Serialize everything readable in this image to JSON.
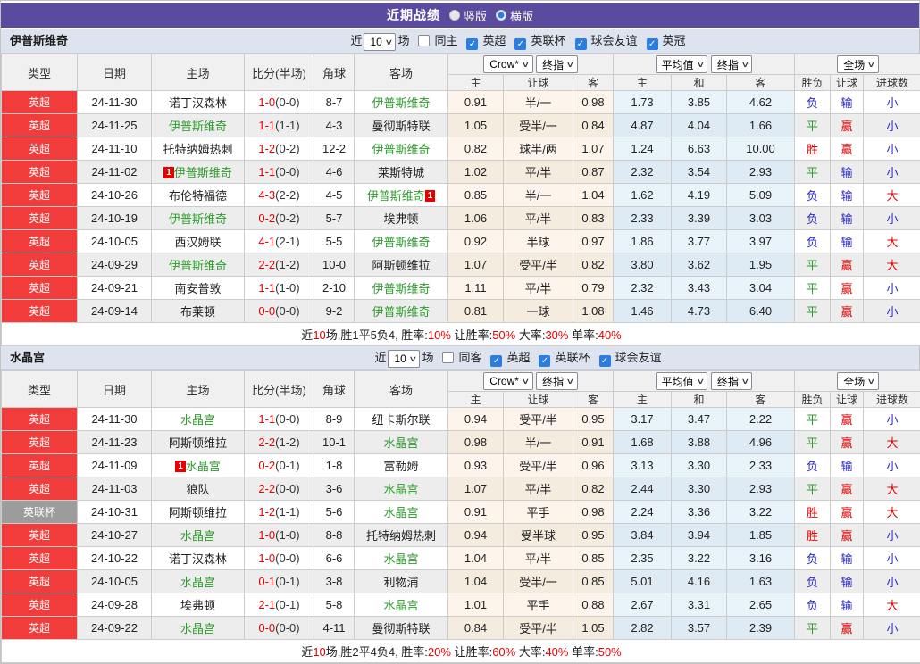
{
  "title_bar": {
    "title": "近期战绩",
    "vertical_label": "竖版",
    "horizontal_label": "横版",
    "selected": "横版"
  },
  "colors": {
    "accent_purple": "#5a4b9f",
    "type_red": "#f23c3c",
    "type_grey": "#9c9c9c",
    "team_green": "#2e9b2e",
    "win_red": "#e60000",
    "lose_blue": "#2a2ace",
    "draw_green": "#2e9b2e"
  },
  "table_header": {
    "cols": {
      "type": "类型",
      "date": "日期",
      "home": "主场",
      "score": "比分(半场)",
      "corner": "角球",
      "away": "客场"
    },
    "selects": {
      "crow": "Crow*",
      "end1": "终指",
      "avg": "平均值",
      "end2": "终指",
      "scope": "全场"
    },
    "sub": [
      "主",
      "让球",
      "客",
      "主",
      "和",
      "客",
      "胜负",
      "让球",
      "进球数"
    ]
  },
  "sections": [
    {
      "team": "伊普斯维奇",
      "filter": {
        "near": "近",
        "count": "10",
        "unit": "场",
        "same_label": "同主",
        "same_checked": false,
        "leagues": [
          "英超",
          "英联杯",
          "球会友谊",
          "英冠"
        ]
      },
      "rows": [
        {
          "type": "英超",
          "grey": false,
          "date": "24-11-30",
          "home": {
            "name": "诺丁汉森林"
          },
          "ft": "1-0",
          "ht": "(0-0)",
          "corner": "8-7",
          "away": {
            "name": "伊普斯维奇",
            "green": true
          },
          "odds": [
            "0.91",
            "半/一",
            "0.98"
          ],
          "avg": [
            "1.73",
            "3.85",
            "4.62"
          ],
          "res": [
            "负",
            "输",
            "小"
          ]
        },
        {
          "type": "英超",
          "grey": false,
          "date": "24-11-25",
          "home": {
            "name": "伊普斯维奇",
            "green": true
          },
          "ft": "1-1",
          "ht": "(1-1)",
          "corner": "4-3",
          "away": {
            "name": "曼彻斯特联"
          },
          "odds": [
            "1.05",
            "受半/一",
            "0.84"
          ],
          "avg": [
            "4.87",
            "4.04",
            "1.66"
          ],
          "res": [
            "平",
            "赢",
            "小"
          ]
        },
        {
          "type": "英超",
          "grey": false,
          "date": "24-11-10",
          "home": {
            "name": "托特纳姆热刺"
          },
          "ft": "1-2",
          "ht": "(0-2)",
          "corner": "12-2",
          "away": {
            "name": "伊普斯维奇",
            "green": true
          },
          "odds": [
            "0.82",
            "球半/两",
            "1.07"
          ],
          "avg": [
            "1.24",
            "6.63",
            "10.00"
          ],
          "res": [
            "胜",
            "赢",
            "小"
          ]
        },
        {
          "type": "英超",
          "grey": false,
          "date": "24-11-02",
          "home": {
            "name": "伊普斯维奇",
            "green": true,
            "badge": "1",
            "badge_pos": "before"
          },
          "ft": "1-1",
          "ht": "(0-0)",
          "corner": "4-6",
          "away": {
            "name": "莱斯特城"
          },
          "odds": [
            "1.02",
            "平/半",
            "0.87"
          ],
          "avg": [
            "2.32",
            "3.54",
            "2.93"
          ],
          "res": [
            "平",
            "输",
            "小"
          ]
        },
        {
          "type": "英超",
          "grey": false,
          "date": "24-10-26",
          "home": {
            "name": "布伦特福德"
          },
          "ft": "4-3",
          "ht": "(2-2)",
          "corner": "4-5",
          "away": {
            "name": "伊普斯维奇",
            "green": true,
            "badge": "1",
            "badge_pos": "after"
          },
          "odds": [
            "0.85",
            "半/一",
            "1.04"
          ],
          "avg": [
            "1.62",
            "4.19",
            "5.09"
          ],
          "res": [
            "负",
            "输",
            "大"
          ]
        },
        {
          "type": "英超",
          "grey": false,
          "date": "24-10-19",
          "home": {
            "name": "伊普斯维奇",
            "green": true
          },
          "ft": "0-2",
          "ht": "(0-2)",
          "corner": "5-7",
          "away": {
            "name": "埃弗顿"
          },
          "odds": [
            "1.06",
            "平/半",
            "0.83"
          ],
          "avg": [
            "2.33",
            "3.39",
            "3.03"
          ],
          "res": [
            "负",
            "输",
            "小"
          ]
        },
        {
          "type": "英超",
          "grey": false,
          "date": "24-10-05",
          "home": {
            "name": "西汉姆联"
          },
          "ft": "4-1",
          "ht": "(2-1)",
          "corner": "5-5",
          "away": {
            "name": "伊普斯维奇",
            "green": true
          },
          "odds": [
            "0.92",
            "半球",
            "0.97"
          ],
          "avg": [
            "1.86",
            "3.77",
            "3.97"
          ],
          "res": [
            "负",
            "输",
            "大"
          ]
        },
        {
          "type": "英超",
          "grey": false,
          "date": "24-09-29",
          "home": {
            "name": "伊普斯维奇",
            "green": true
          },
          "ft": "2-2",
          "ht": "(1-2)",
          "corner": "10-0",
          "away": {
            "name": "阿斯顿维拉"
          },
          "odds": [
            "1.07",
            "受平/半",
            "0.82"
          ],
          "avg": [
            "3.80",
            "3.62",
            "1.95"
          ],
          "res": [
            "平",
            "赢",
            "大"
          ]
        },
        {
          "type": "英超",
          "grey": false,
          "date": "24-09-21",
          "home": {
            "name": "南安普敦"
          },
          "ft": "1-1",
          "ht": "(1-0)",
          "corner": "2-10",
          "away": {
            "name": "伊普斯维奇",
            "green": true
          },
          "odds": [
            "1.11",
            "平/半",
            "0.79"
          ],
          "avg": [
            "2.32",
            "3.43",
            "3.04"
          ],
          "res": [
            "平",
            "赢",
            "小"
          ]
        },
        {
          "type": "英超",
          "grey": false,
          "date": "24-09-14",
          "home": {
            "name": "布莱顿"
          },
          "ft": "0-0",
          "ht": "(0-0)",
          "corner": "9-2",
          "away": {
            "name": "伊普斯维奇",
            "green": true
          },
          "odds": [
            "0.81",
            "一球",
            "1.08"
          ],
          "avg": [
            "1.46",
            "4.73",
            "6.40"
          ],
          "res": [
            "平",
            "赢",
            "小"
          ]
        }
      ],
      "summary": [
        {
          "t": "近"
        },
        {
          "t": "10",
          "red": true
        },
        {
          "t": "场,胜1平5负4, 胜率:"
        },
        {
          "t": "10%",
          "red": true
        },
        {
          "t": " 让胜率:"
        },
        {
          "t": "50%",
          "red": true
        },
        {
          "t": " 大率:"
        },
        {
          "t": "30%",
          "red": true
        },
        {
          "t": " 单率:"
        },
        {
          "t": "40%",
          "red": true
        }
      ]
    },
    {
      "team": "水晶宫",
      "filter": {
        "near": "近",
        "count": "10",
        "unit": "场",
        "same_label": "同客",
        "same_checked": false,
        "leagues": [
          "英超",
          "英联杯",
          "球会友谊"
        ]
      },
      "rows": [
        {
          "type": "英超",
          "grey": false,
          "date": "24-11-30",
          "home": {
            "name": "水晶宫",
            "green": true
          },
          "ft": "1-1",
          "ht": "(0-0)",
          "corner": "8-9",
          "away": {
            "name": "纽卡斯尔联"
          },
          "odds": [
            "0.94",
            "受平/半",
            "0.95"
          ],
          "avg": [
            "3.17",
            "3.47",
            "2.22"
          ],
          "res": [
            "平",
            "赢",
            "小"
          ]
        },
        {
          "type": "英超",
          "grey": false,
          "date": "24-11-23",
          "home": {
            "name": "阿斯顿维拉"
          },
          "ft": "2-2",
          "ht": "(1-2)",
          "corner": "10-1",
          "away": {
            "name": "水晶宫",
            "green": true
          },
          "odds": [
            "0.98",
            "半/一",
            "0.91"
          ],
          "avg": [
            "1.68",
            "3.88",
            "4.96"
          ],
          "res": [
            "平",
            "赢",
            "大"
          ]
        },
        {
          "type": "英超",
          "grey": false,
          "date": "24-11-09",
          "home": {
            "name": "水晶宫",
            "green": true,
            "badge": "1",
            "badge_pos": "before"
          },
          "ft": "0-2",
          "ht": "(0-1)",
          "corner": "1-8",
          "away": {
            "name": "富勒姆"
          },
          "odds": [
            "0.93",
            "受平/半",
            "0.96"
          ],
          "avg": [
            "3.13",
            "3.30",
            "2.33"
          ],
          "res": [
            "负",
            "输",
            "小"
          ]
        },
        {
          "type": "英超",
          "grey": false,
          "date": "24-11-03",
          "home": {
            "name": "狼队"
          },
          "ft": "2-2",
          "ht": "(0-0)",
          "corner": "3-6",
          "away": {
            "name": "水晶宫",
            "green": true
          },
          "odds": [
            "1.07",
            "平/半",
            "0.82"
          ],
          "avg": [
            "2.44",
            "3.30",
            "2.93"
          ],
          "res": [
            "平",
            "赢",
            "大"
          ]
        },
        {
          "type": "英联杯",
          "grey": true,
          "date": "24-10-31",
          "home": {
            "name": "阿斯顿维拉"
          },
          "ft": "1-2",
          "ht": "(1-1)",
          "corner": "5-6",
          "away": {
            "name": "水晶宫",
            "green": true
          },
          "odds": [
            "0.91",
            "平手",
            "0.98"
          ],
          "avg": [
            "2.24",
            "3.36",
            "3.22"
          ],
          "res": [
            "胜",
            "赢",
            "大"
          ]
        },
        {
          "type": "英超",
          "grey": false,
          "date": "24-10-27",
          "home": {
            "name": "水晶宫",
            "green": true
          },
          "ft": "1-0",
          "ht": "(1-0)",
          "corner": "8-8",
          "away": {
            "name": "托特纳姆热刺"
          },
          "odds": [
            "0.94",
            "受半球",
            "0.95"
          ],
          "avg": [
            "3.84",
            "3.94",
            "1.85"
          ],
          "res": [
            "胜",
            "赢",
            "小"
          ]
        },
        {
          "type": "英超",
          "grey": false,
          "date": "24-10-22",
          "home": {
            "name": "诺丁汉森林"
          },
          "ft": "1-0",
          "ht": "(0-0)",
          "corner": "6-6",
          "away": {
            "name": "水晶宫",
            "green": true
          },
          "odds": [
            "1.04",
            "平/半",
            "0.85"
          ],
          "avg": [
            "2.35",
            "3.22",
            "3.16"
          ],
          "res": [
            "负",
            "输",
            "小"
          ]
        },
        {
          "type": "英超",
          "grey": false,
          "date": "24-10-05",
          "home": {
            "name": "水晶宫",
            "green": true
          },
          "ft": "0-1",
          "ht": "(0-1)",
          "corner": "3-8",
          "away": {
            "name": "利物浦"
          },
          "odds": [
            "1.04",
            "受半/一",
            "0.85"
          ],
          "avg": [
            "5.01",
            "4.16",
            "1.63"
          ],
          "res": [
            "负",
            "输",
            "小"
          ]
        },
        {
          "type": "英超",
          "grey": false,
          "date": "24-09-28",
          "home": {
            "name": "埃弗顿"
          },
          "ft": "2-1",
          "ht": "(0-1)",
          "corner": "5-8",
          "away": {
            "name": "水晶宫",
            "green": true
          },
          "odds": [
            "1.01",
            "平手",
            "0.88"
          ],
          "avg": [
            "2.67",
            "3.31",
            "2.65"
          ],
          "res": [
            "负",
            "输",
            "大"
          ]
        },
        {
          "type": "英超",
          "grey": false,
          "date": "24-09-22",
          "home": {
            "name": "水晶宫",
            "green": true
          },
          "ft": "0-0",
          "ht": "(0-0)",
          "corner": "4-11",
          "away": {
            "name": "曼彻斯特联"
          },
          "odds": [
            "0.84",
            "受平/半",
            "1.05"
          ],
          "avg": [
            "2.82",
            "3.57",
            "2.39"
          ],
          "res": [
            "平",
            "赢",
            "小"
          ]
        }
      ],
      "summary": [
        {
          "t": "近"
        },
        {
          "t": "10",
          "red": true
        },
        {
          "t": "场,胜2平4负4, 胜率:"
        },
        {
          "t": "20%",
          "red": true
        },
        {
          "t": " 让胜率:"
        },
        {
          "t": "60%",
          "red": true
        },
        {
          "t": " 大率:"
        },
        {
          "t": "40%",
          "red": true
        },
        {
          "t": " 单率:"
        },
        {
          "t": "50%",
          "red": true
        }
      ]
    }
  ]
}
